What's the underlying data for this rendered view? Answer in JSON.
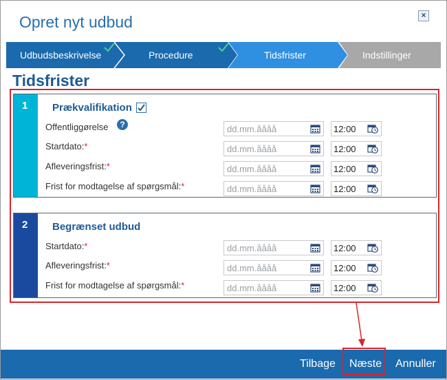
{
  "dialog": {
    "title": "Opret nyt udbud",
    "close_symbol": "×"
  },
  "wizard": {
    "steps": [
      {
        "label": "Udbudsbeskrivelse",
        "state": "done"
      },
      {
        "label": "Procedure",
        "state": "done"
      },
      {
        "label": "Tidsfrister",
        "state": "active"
      },
      {
        "label": "Indstillinger",
        "state": "pending"
      }
    ],
    "colors": {
      "done": "#1a6aad",
      "active": "#2f8fe0",
      "pending": "#a8a8a8",
      "check": "#4cc496"
    }
  },
  "page_title": "Tidsfrister",
  "sections": [
    {
      "number": "1",
      "title": "Prækvalifikation",
      "checkbox_checked": true,
      "rows": [
        {
          "label": "Offentliggørelse",
          "required": "",
          "help": "?",
          "date_placeholder": "dd.mm.åååå",
          "time": "12:00"
        },
        {
          "label": "Startdato:",
          "required": "*",
          "date_placeholder": "dd.mm.åååå",
          "time": "12:00"
        },
        {
          "label": "Afleveringsfrist:",
          "required": "*",
          "date_placeholder": "dd.mm.åååå",
          "time": "12:00"
        },
        {
          "label": "Frist for modtagelse af spørgsmål:",
          "required": "*",
          "date_placeholder": "dd.mm.åååå",
          "time": "12:00"
        }
      ]
    },
    {
      "number": "2",
      "title": "Begrænset udbud",
      "rows": [
        {
          "label": "Startdato:",
          "required": "*",
          "date_placeholder": "dd.mm.åååå",
          "time": "12:00"
        },
        {
          "label": "Afleveringsfrist:",
          "required": "*",
          "date_placeholder": "dd.mm.åååå",
          "time": "12:00"
        },
        {
          "label": "Frist for modtagelse af spørgsmål:",
          "required": "*",
          "date_placeholder": "dd.mm.åååå",
          "time": "12:00"
        }
      ]
    }
  ],
  "footer": {
    "back": "Tilbage",
    "next": "Næste",
    "cancel": "Annuller"
  },
  "accent_colors": {
    "section1": "#00b4d8",
    "section2": "#1a4aa0",
    "annotation": "#d9242b"
  }
}
